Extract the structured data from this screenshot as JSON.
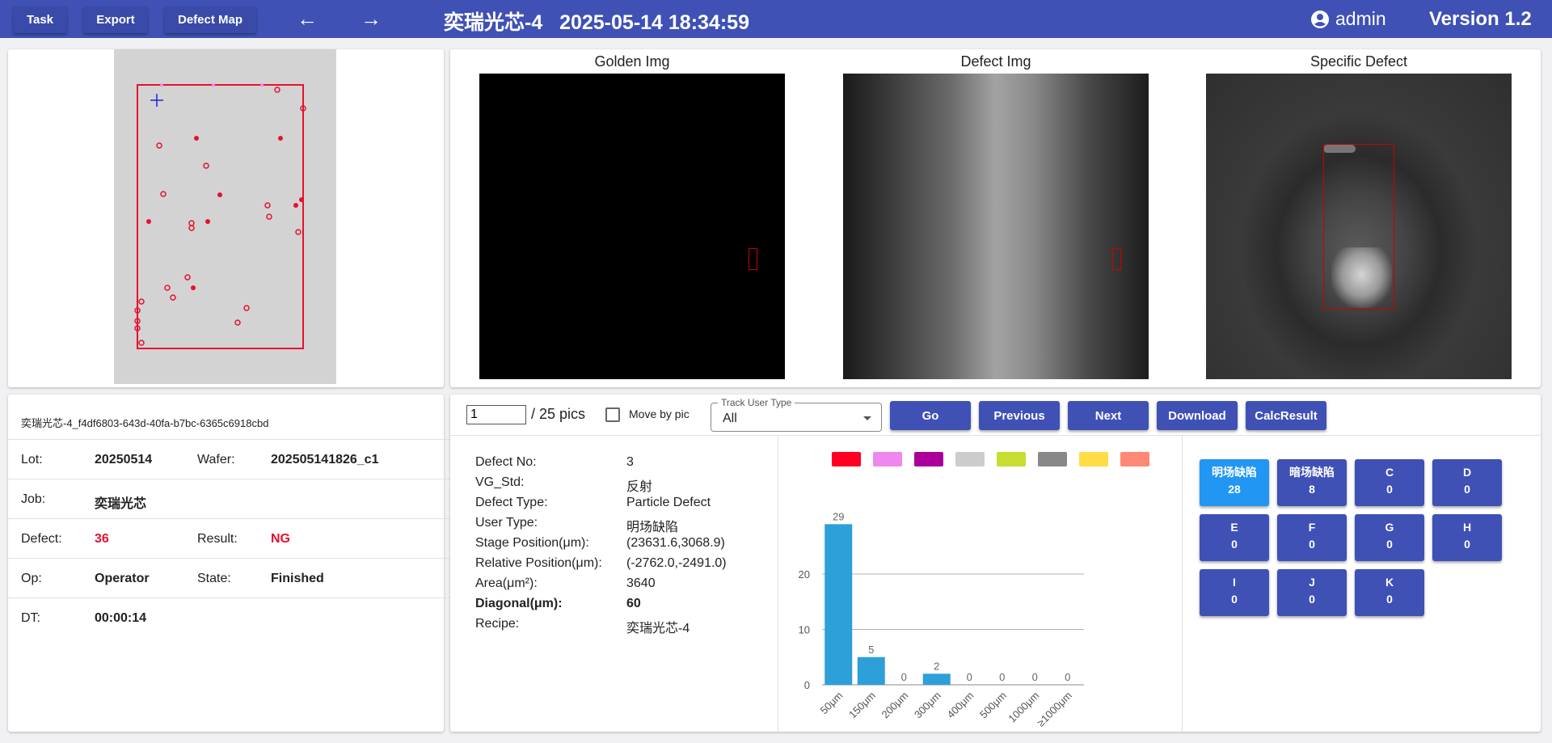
{
  "toolbar": {
    "task_label": "Task",
    "export_label": "Export",
    "defect_map_label": "Defect Map",
    "back_icon": "←",
    "forward_icon": "→",
    "title": "奕瑞光芯-4   2025-05-14 18:34:59",
    "user": "admin",
    "version": "Version 1.2"
  },
  "images": {
    "golden_title": "Golden Img",
    "defect_title": "Defect Img",
    "specific_title": "Specific Defect"
  },
  "info": {
    "id": "奕瑞光芯-4_f4df6803-643d-40fa-b7bc-6365c6918cbd",
    "lot_label": "Lot:",
    "lot_value": "20250514",
    "wafer_label": "Wafer:",
    "wafer_value": "202505141826_c1",
    "job_label": "Job:",
    "job_value": "奕瑞光芯",
    "defect_label": "Defect:",
    "defect_value": "36",
    "result_label": "Result:",
    "result_value": "NG",
    "op_label": "Op:",
    "op_value": "Operator",
    "state_label": "State:",
    "state_value": "Finished",
    "dt_label": "DT:",
    "dt_value": "00:00:14"
  },
  "controls": {
    "page_value": "1",
    "total": "/ 25 pics",
    "move_by_pic": "Move by pic",
    "track_label": "Track User Type",
    "track_value": "All",
    "go": "Go",
    "previous": "Previous",
    "next": "Next",
    "download": "Download",
    "calc": "CalcResult"
  },
  "details": [
    {
      "label": "Defect No:",
      "value": "3",
      "bold": false
    },
    {
      "label": "VG_Std:",
      "value": "反射",
      "bold": false
    },
    {
      "label": "Defect Type:",
      "value": "Particle Defect",
      "bold": false
    },
    {
      "label": "User Type:",
      "value": "明场缺陷",
      "bold": false
    },
    {
      "label": "Stage Position(μm):",
      "value": "(23631.6,3068.9)",
      "bold": false
    },
    {
      "label": "Relative Position(μm):",
      "value": "(-2762.0,-2491.0)",
      "bold": false
    },
    {
      "label": "Area(μm²):",
      "value": "3640",
      "bold": false
    },
    {
      "label": "Diagonal(μm):",
      "value": "60",
      "bold": true
    },
    {
      "label": "Recipe:",
      "value": "奕瑞光芯-4",
      "bold": false
    }
  ],
  "legend_colors": [
    "#ff0022",
    "#ee88ee",
    "#aa0099",
    "#cccccc",
    "#c8dd33",
    "#888888",
    "#ffdd44",
    "#ff8877"
  ],
  "chart_data": {
    "type": "bar",
    "categories": [
      "50μm",
      "150μm",
      "200μm",
      "300μm",
      "400μm",
      "500μm",
      "1000μm",
      "≥1000μm"
    ],
    "values": [
      29,
      5,
      0,
      2,
      0,
      0,
      0,
      0
    ],
    "ylim": [
      0,
      30
    ],
    "yticks": [
      0,
      10,
      20
    ],
    "grid": true,
    "color": "#2d9fd9"
  },
  "count_buttons": [
    {
      "label": "明场缺陷",
      "count": "28",
      "active": true
    },
    {
      "label": "暗场缺陷",
      "count": "8",
      "active": false
    },
    {
      "label": "C",
      "count": "0",
      "active": false
    },
    {
      "label": "D",
      "count": "0",
      "active": false
    },
    {
      "label": "E",
      "count": "0",
      "active": false
    },
    {
      "label": "F",
      "count": "0",
      "active": false
    },
    {
      "label": "G",
      "count": "0",
      "active": false
    },
    {
      "label": "H",
      "count": "0",
      "active": false
    },
    {
      "label": "I",
      "count": "0",
      "active": false
    },
    {
      "label": "J",
      "count": "0",
      "active": false
    },
    {
      "label": "K",
      "count": "0",
      "active": false
    }
  ]
}
